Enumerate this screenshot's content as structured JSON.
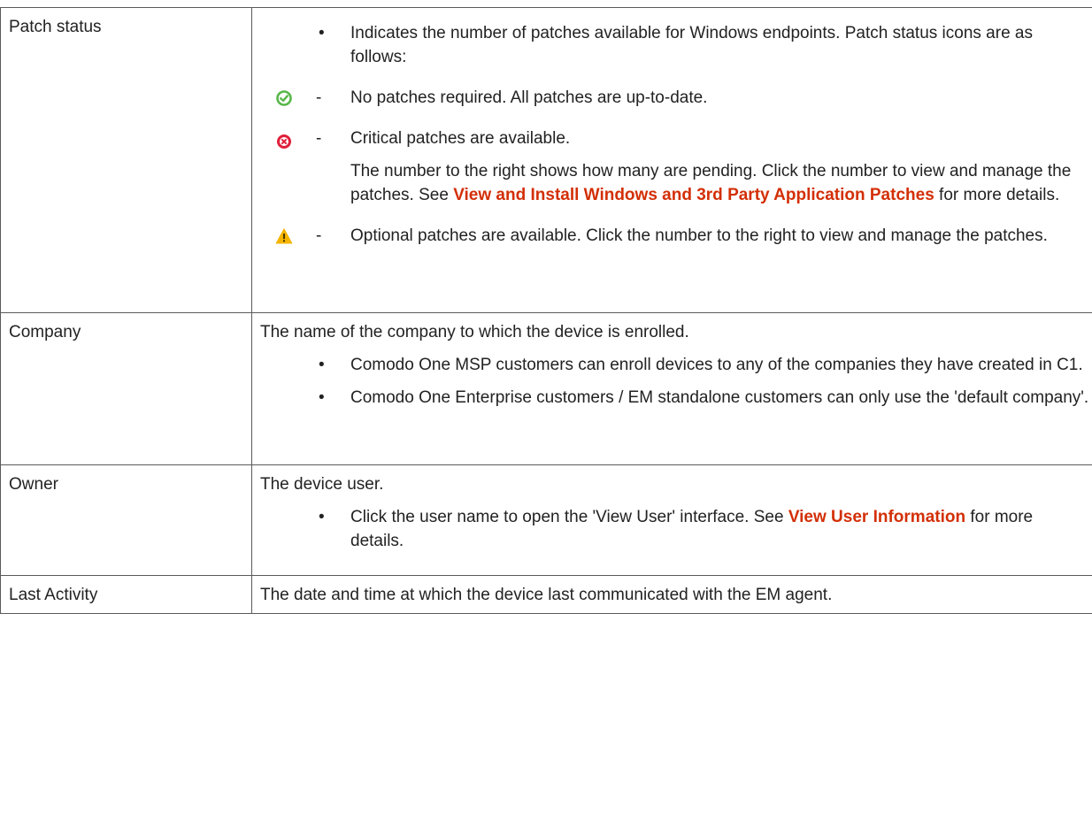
{
  "rows": [
    {
      "term": "Patch status",
      "intro": "Indicates the number of patches available for Windows endpoints. Patch status icons are as follows:",
      "items": [
        {
          "icon": "check-circle-icon",
          "text": "No patches required. All patches are up-to-date."
        },
        {
          "icon": "critical-x-circle-icon",
          "text": "Critical patches are available."
        },
        {
          "icon": "warning-triangle-icon",
          "text": "Optional patches are available. Click the number to the right to view and manage the patches."
        }
      ],
      "critical_note_before": "The number to the right shows how many are pending. Click the number to view and manage the patches. See ",
      "critical_note_link": "View and Install Windows and 3rd Party Application Patches",
      "critical_note_after": " for more details."
    },
    {
      "term": "Company",
      "desc": "The name of the company to which the device is enrolled.",
      "bullets": [
        "Comodo One MSP customers can enroll devices to any of the companies they have created in C1.",
        "Comodo One Enterprise customers / EM standalone customers can only use the 'default company'."
      ]
    },
    {
      "term": "Owner",
      "desc": "The device user.",
      "bullet_before": "Click the user name to open the 'View User' interface. See ",
      "bullet_link": "View User Information",
      "bullet_after": " for more details."
    },
    {
      "term": "Last Activity",
      "desc": "The date and time at which the device last communicated with the EM agent."
    }
  ],
  "bullet_char": "•",
  "dash_char": "-",
  "colors": {
    "link": "#d32f06",
    "border": "#5a5a5a",
    "ok_green": "#58b74a",
    "critical_red": "#e0203a",
    "warning_yellow": "#f5b400"
  }
}
